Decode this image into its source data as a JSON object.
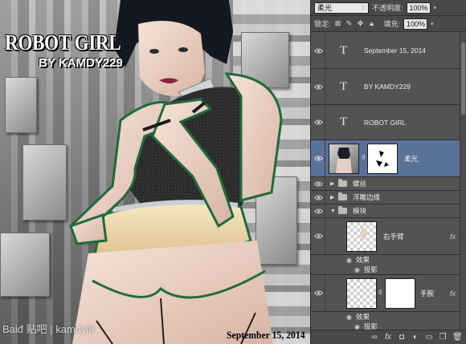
{
  "canvas": {
    "title": "ROBOT GIRL",
    "subtitle": "BY  KAMDY229",
    "date": "September 15, 2014",
    "watermark": "Baiđ 贴吧 | kamdyl8"
  },
  "panel": {
    "blend_mode": "柔光",
    "opacity_label": "不透明度:",
    "opacity_value": "100%",
    "lock_label": "锁定:",
    "fill_label": "填充:",
    "fill_value": "100%",
    "layers": [
      {
        "name": "September 15, 2014",
        "type": "text"
      },
      {
        "name": "BY  KAMDY229",
        "type": "text"
      },
      {
        "name": "ROBOT GIRL",
        "type": "text"
      },
      {
        "name": "柔光",
        "type": "image-mask",
        "selected": true
      },
      {
        "name": "螺丝",
        "type": "group"
      },
      {
        "name": "浮雕边缘",
        "type": "group"
      },
      {
        "name": "模块",
        "type": "group-open"
      },
      {
        "name": "右手臂",
        "type": "pixel",
        "fx": "fx"
      },
      {
        "name": "效果",
        "type": "effect-label"
      },
      {
        "name": "投影",
        "type": "effect"
      },
      {
        "name": "手腕",
        "type": "pixel-mask",
        "fx": "fx"
      },
      {
        "name": "效果",
        "type": "effect-label"
      },
      {
        "name": "投影",
        "type": "effect"
      }
    ]
  },
  "icons": {
    "eye": "eye-icon",
    "text_layer": "text-layer-icon",
    "folder": "folder-icon",
    "link": "link-icon",
    "fx": "fx-icon"
  },
  "colors": {
    "panel_bg": "#535353",
    "selected_layer": "#5a7198",
    "armor_green": "#1f6b3a"
  }
}
